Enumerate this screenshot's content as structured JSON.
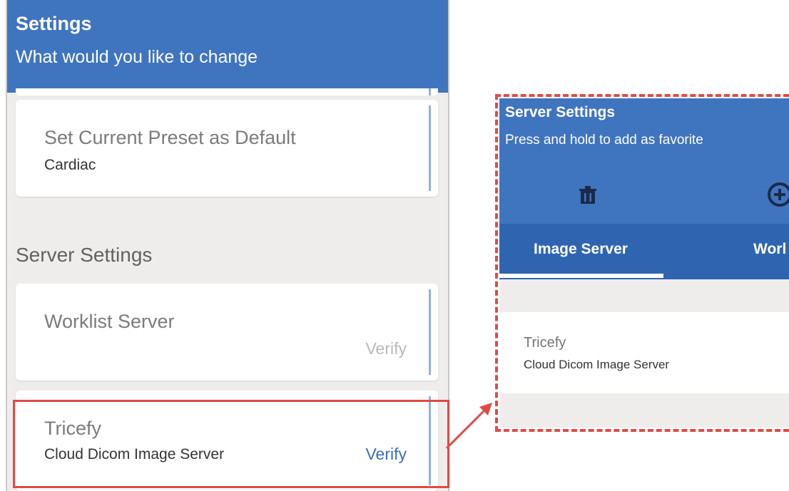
{
  "left": {
    "header": {
      "title": "Settings",
      "subtitle": "What would you like to change"
    },
    "preset_card": {
      "title": "Set Current Preset as Default",
      "value": "Cardiac"
    },
    "section_label": "Server Settings",
    "worklist_card": {
      "title": "Worklist Server",
      "action": "Verify"
    },
    "tricefy_card": {
      "title": "Tricefy",
      "subtitle": "Cloud Dicom Image Server",
      "action": "Verify"
    }
  },
  "zoom": {
    "header": {
      "title": "Server Settings",
      "subtitle": "Press and hold to add as favorite"
    },
    "toolbar": {
      "delete_icon": "trash-icon",
      "add_icon": "plus-circle-icon"
    },
    "tabs": [
      {
        "label": "Image Server",
        "active": true
      },
      {
        "label": "Worl",
        "active": false
      }
    ],
    "card": {
      "title": "Tricefy",
      "subtitle": "Cloud Dicom Image Server"
    }
  },
  "colors": {
    "header_blue": "#3f74bf",
    "tab_blue": "#2f65b0",
    "highlight_red": "#e04a45",
    "verify_active": "#3d6fb9",
    "verify_inactive": "#b9b9b9",
    "background_gray": "#efedec"
  }
}
